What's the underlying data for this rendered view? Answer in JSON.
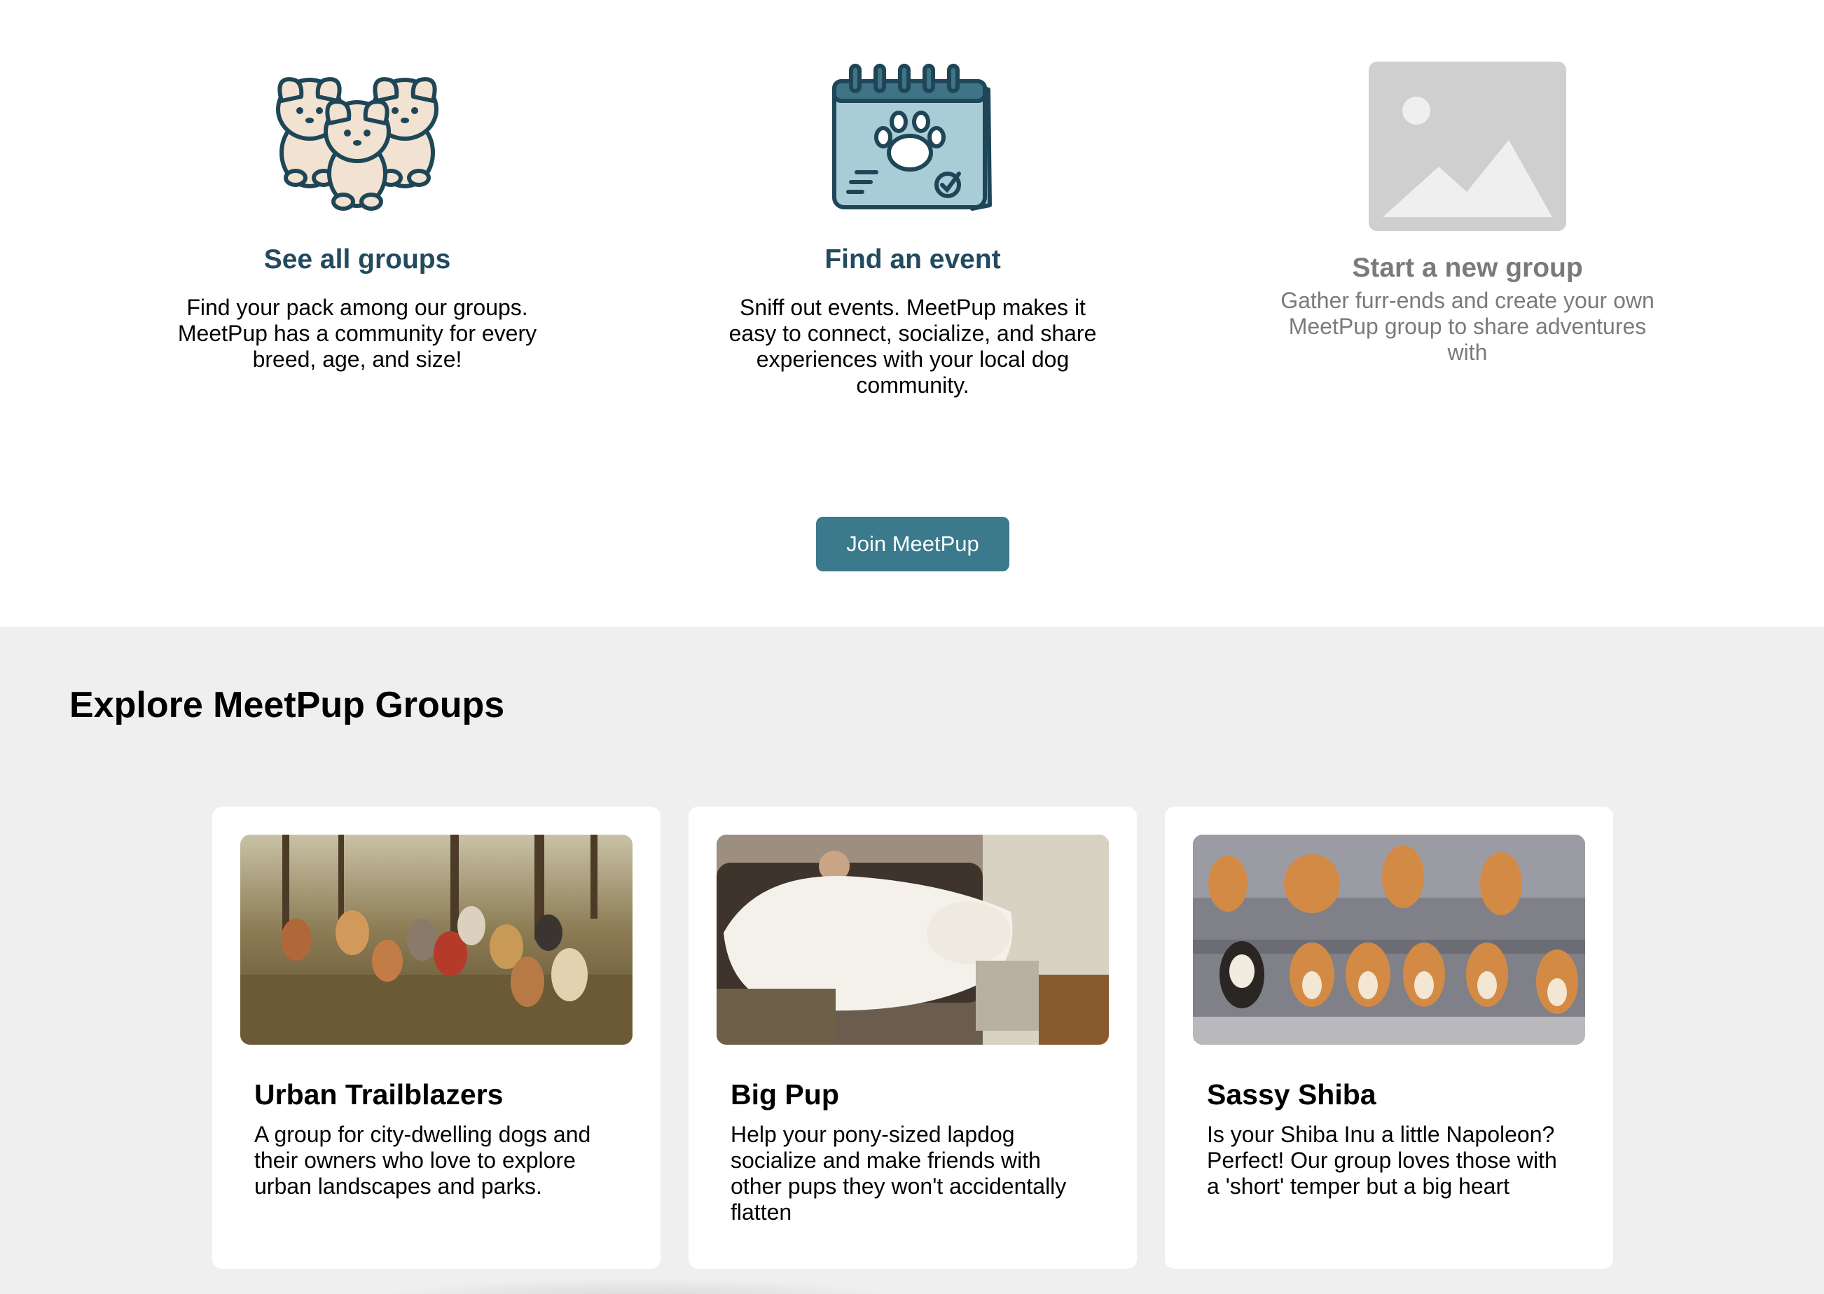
{
  "features": [
    {
      "icon": "dogs-group-icon",
      "title": "See all groups",
      "description": "Find your pack among our groups. MeetPup has a community for every breed, age, and size!"
    },
    {
      "icon": "paw-calendar-icon",
      "title": "Find an event",
      "description": "Sniff out events. MeetPup makes it easy to connect, socialize, and share experiences with your local dog community."
    },
    {
      "icon": "image-placeholder-icon",
      "title": "Start a new group",
      "description": "Gather furr-ends and create your own MeetPup group to share adventures with"
    }
  ],
  "join_button_label": "Join MeetPup",
  "explore": {
    "title": "Explore MeetPup Groups",
    "groups": [
      {
        "name": "Urban Trailblazers",
        "description": "A group for city-dwelling dogs and their owners who love to explore urban landscapes and parks."
      },
      {
        "name": "Big Pup",
        "description": "Help your pony-sized lapdog socialize and make friends with other pups they won't accidentally flatten"
      },
      {
        "name": "Sassy Shiba",
        "description": "Is your Shiba Inu a little Napoleon? Perfect! Our group loves those with a 'short' temper but a big heart"
      }
    ]
  },
  "colors": {
    "heading": "#234a5e",
    "button": "#3a7a8c",
    "muted": "#7a7a7a",
    "explore_bg": "#efefef"
  }
}
